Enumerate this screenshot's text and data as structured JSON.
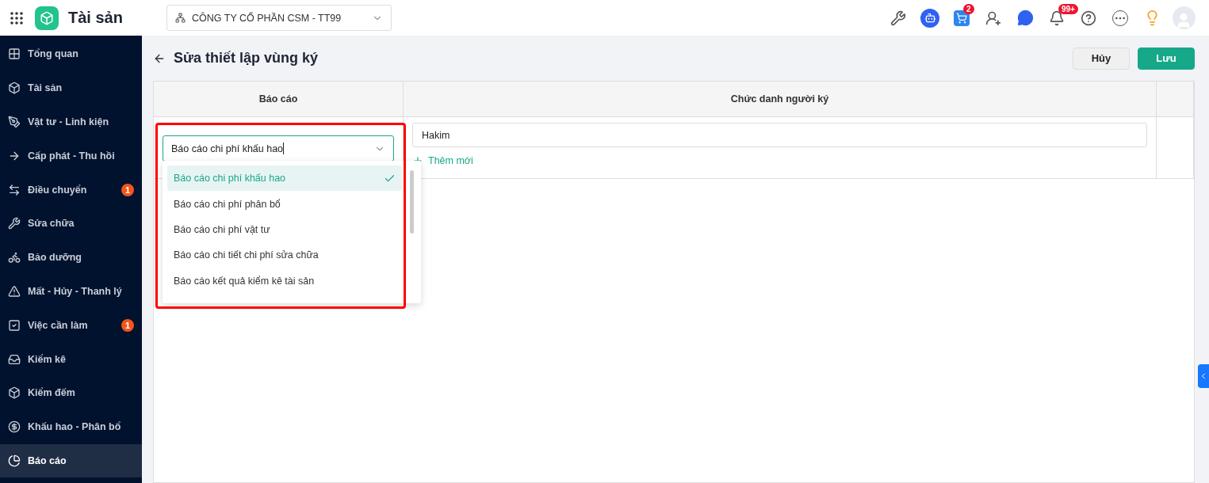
{
  "app": {
    "title": "Tài sản"
  },
  "company_select": {
    "value": "CÔNG TY CỔ PHẦN CSM - TT99"
  },
  "toolbar": [
    {
      "kind": "tools"
    },
    {
      "kind": "robot"
    },
    {
      "kind": "cart",
      "badge": "2"
    },
    {
      "kind": "add-user"
    },
    {
      "kind": "chat"
    },
    {
      "kind": "bell",
      "badge": "99+"
    },
    {
      "kind": "help"
    },
    {
      "kind": "more"
    },
    {
      "kind": "guide"
    },
    {
      "kind": "avatar"
    }
  ],
  "sidebar": {
    "items": [
      {
        "kind": "grid",
        "label": "Tổng quan",
        "selected": false
      },
      {
        "kind": "box",
        "label": "Tài sản",
        "selected": false
      },
      {
        "kind": "pen",
        "label": "Vật tư - Linh kiện",
        "selected": false
      },
      {
        "kind": "user-arrow",
        "label": "Cấp phát - Thu hồi",
        "selected": false
      },
      {
        "kind": "swap",
        "label": "Điều chuyển",
        "badge": "1",
        "selected": false
      },
      {
        "kind": "wrench",
        "label": "Sửa chữa",
        "selected": false
      },
      {
        "kind": "bike",
        "label": "Bảo dưỡng",
        "selected": false
      },
      {
        "kind": "warning",
        "label": "Mất - Hủy - Thanh lý",
        "selected": false
      },
      {
        "kind": "check",
        "label": "Việc cần làm",
        "badge": "1",
        "selected": false
      },
      {
        "kind": "inbox",
        "label": "Kiểm kê",
        "selected": false
      },
      {
        "kind": "box",
        "label": "Kiểm đếm",
        "selected": false
      },
      {
        "kind": "coin",
        "label": "Khấu hao - Phân bổ",
        "selected": false
      },
      {
        "kind": "pie",
        "label": "Báo cáo",
        "selected": true
      }
    ]
  },
  "page": {
    "title": "Sửa thiết lập vùng ký",
    "buttons": [
      {
        "kind": "secondary",
        "label": "Hủy"
      },
      {
        "kind": "primary",
        "label": "Lưu"
      }
    ]
  },
  "table": {
    "columns": [
      "Báo cáo",
      "Chức danh người ký"
    ],
    "row": {
      "report_select": {
        "value": "Báo cáo chi phí khấu hao",
        "expanded": true,
        "options": [
          {
            "label": "Báo cáo chi phí khấu hao",
            "selected": true
          },
          {
            "label": "Báo cáo chi phí phân bổ",
            "selected": false
          },
          {
            "label": "Báo cáo chi phí vật tư",
            "selected": false
          },
          {
            "label": "Báo cáo chi tiết chi phí sửa chữa",
            "selected": false
          },
          {
            "label": "Báo cáo kết quả kiểm kê tài sản",
            "selected": false
          }
        ]
      },
      "signer_titles": [
        {
          "value": "Hakim"
        }
      ],
      "add_link": "Thêm mới"
    }
  }
}
